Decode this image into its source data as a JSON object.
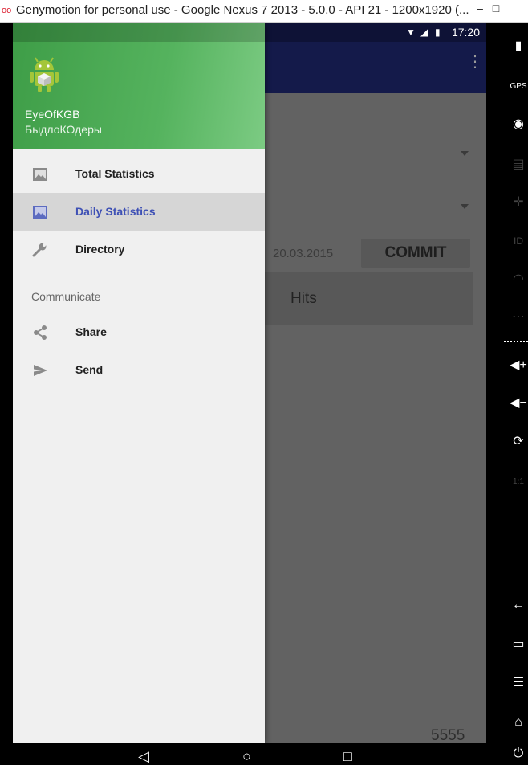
{
  "window": {
    "title": "Genymotion for personal use - Google Nexus 7 2013 - 5.0.0 - API 21 - 1200x1920 (...",
    "minimize_label": "–",
    "maximize_label": "□"
  },
  "status_bar": {
    "time": "17:20"
  },
  "drawer": {
    "account_name": "EyeOfKGB",
    "account_subtitle": "БыдлоКОдеры",
    "items": [
      {
        "label": "Total Statistics",
        "icon": "image-icon",
        "active": false
      },
      {
        "label": "Daily Statistics",
        "icon": "image-icon",
        "active": true
      },
      {
        "label": "Directory",
        "icon": "wrench-icon",
        "active": false
      }
    ],
    "section_title": "Communicate",
    "section_items": [
      {
        "label": "Share",
        "icon": "share-icon"
      },
      {
        "label": "Send",
        "icon": "send-icon"
      }
    ]
  },
  "content": {
    "date": "20.03.2015",
    "commit_label": "COMMIT",
    "table_header": "Hits",
    "number_value": "5555"
  },
  "colors": {
    "drawer_header": "#4caf50",
    "app_bar": "#1a237e",
    "active_item_text": "#3f51b5"
  }
}
